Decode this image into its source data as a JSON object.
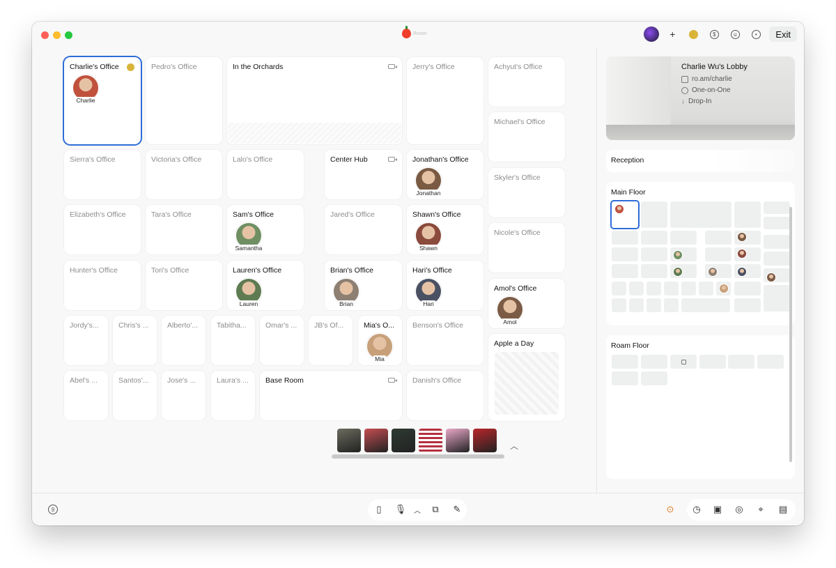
{
  "titlebar": {
    "logo_text": "Roam",
    "exit_label": "Exit"
  },
  "rooms": [
    {
      "key": "charlie",
      "name": "Charlie's Office",
      "occupant": "Charlie",
      "color": "#c0513d"
    },
    {
      "key": "pedro",
      "name": "Pedro's Office"
    },
    {
      "key": "orchards",
      "name": "In the Orchards"
    },
    {
      "key": "jerry",
      "name": "Jerry's Office"
    },
    {
      "key": "achyut",
      "name": "Achyut's Office"
    },
    {
      "key": "michael",
      "name": "Michael's Office"
    },
    {
      "key": "sierra",
      "name": "Sierra's Office"
    },
    {
      "key": "victoria",
      "name": "Victoria's Office"
    },
    {
      "key": "lalo",
      "name": "Lalo's Office"
    },
    {
      "key": "centerhub",
      "name": "Center Hub"
    },
    {
      "key": "jonathan",
      "name": "Jonathan's Office",
      "occupant": "Jonathan",
      "color": "#7a5a43"
    },
    {
      "key": "skyler",
      "name": "Skyler's Office"
    },
    {
      "key": "elizabeth",
      "name": "Elizabeth's Office"
    },
    {
      "key": "tara",
      "name": "Tara's Office"
    },
    {
      "key": "sam",
      "name": "Sam's Office",
      "occupant": "Samantha",
      "color": "#6f8f63"
    },
    {
      "key": "jared",
      "name": "Jared's Office"
    },
    {
      "key": "shawn",
      "name": "Shawn's Office",
      "occupant": "Shawn",
      "color": "#8a4a3c"
    },
    {
      "key": "nicole",
      "name": "Nicole's Office"
    },
    {
      "key": "hunter",
      "name": "Hunter's Office"
    },
    {
      "key": "tori",
      "name": "Tori's Office"
    },
    {
      "key": "lauren",
      "name": "Lauren's Office",
      "occupant": "Lauren",
      "color": "#5f7b52"
    },
    {
      "key": "brian",
      "name": "Brian's Office",
      "occupant": "Brian",
      "color": "#8d7f72"
    },
    {
      "key": "hari",
      "name": "Hari's Office",
      "occupant": "Hari",
      "color": "#4a5163"
    },
    {
      "key": "amol",
      "name": "Amol's Office",
      "occupant": "Amol",
      "color": "#7b5b45"
    },
    {
      "key": "jordy",
      "name": "Jordy's..."
    },
    {
      "key": "chris",
      "name": "Chris's ..."
    },
    {
      "key": "alberto",
      "name": "Alberto'..."
    },
    {
      "key": "tabitha",
      "name": "Tabitha..."
    },
    {
      "key": "omar",
      "name": "Omar's ..."
    },
    {
      "key": "jb",
      "name": "JB's Of..."
    },
    {
      "key": "mia",
      "name": "Mia's O...",
      "occupant": "Mia",
      "color": "#c7a07a"
    },
    {
      "key": "benson",
      "name": "Benson's Office"
    },
    {
      "key": "appleday",
      "name": "Apple a Day"
    },
    {
      "key": "abel",
      "name": "Abel's ..."
    },
    {
      "key": "santos",
      "name": "Santos'..."
    },
    {
      "key": "jose",
      "name": "Jose's ..."
    },
    {
      "key": "laura",
      "name": "Laura's ..."
    },
    {
      "key": "baseroom",
      "name": "Base Room"
    },
    {
      "key": "danish",
      "name": "Danish's Office"
    }
  ],
  "tray_thumbs": [
    "#6b6b5e",
    "#c44d52",
    "#2e3a33",
    "#b4303f",
    "#e8a8c8",
    "#b8262b"
  ],
  "lobby": {
    "title": "Charlie Wu's Lobby",
    "link": "ro.am/charlie",
    "type": "One-on-One",
    "mode": "Drop-In"
  },
  "reception_label": "Reception",
  "main_floor_label": "Main Floor",
  "roam_floor_label": "Roam Floor",
  "accent": "#2e6cd9"
}
